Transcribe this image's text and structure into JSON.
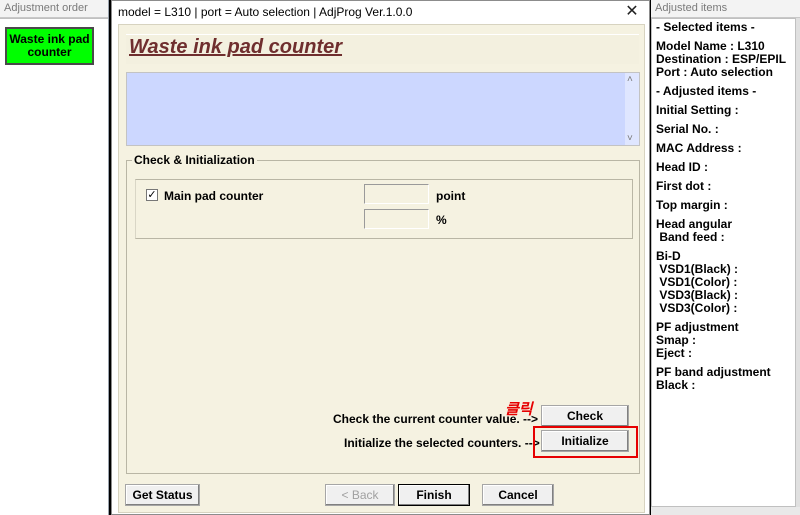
{
  "left_panel": {
    "title": "Adjustment order",
    "item": "Waste ink pad counter",
    "item_color": "#00ff00"
  },
  "right_panel": {
    "title": "Adjusted items",
    "lines": [
      "- Selected items -",
      "",
      "Model Name : L310",
      "Destination : ESP/EPIL",
      "Port : Auto selection",
      "",
      "- Adjusted items -",
      "",
      "Initial Setting :",
      "",
      "Serial No. :",
      "",
      "MAC Address :",
      "",
      "Head ID :",
      "",
      "First dot :",
      "",
      "Top margin :",
      "",
      "Head angular",
      " Band feed :",
      "",
      "Bi-D",
      " VSD1(Black) :",
      " VSD1(Color) :",
      " VSD3(Black) :",
      " VSD3(Color) :",
      "",
      "PF adjustment",
      "Smap :",
      "Eject :",
      "",
      "PF band adjustment",
      "Black :"
    ]
  },
  "dialog": {
    "window_title": "model = L310 | port = Auto selection | AdjProg Ver.1.0.0",
    "close_icon": "close-icon",
    "page_title": "Waste ink pad counter",
    "title_color": "#6f2e2e",
    "message_text": "",
    "group_label": "Check & Initialization",
    "main_pad": {
      "label": "Main pad counter",
      "checked": true,
      "check_mark": "✓",
      "point_value": "",
      "point_unit": "point",
      "percent_value": "",
      "percent_unit": "%"
    },
    "check_text": "Check the current counter value. -->",
    "init_text": "Initialize the selected counters. -->",
    "hand_note": "클릭",
    "highlight_color": "#e60000",
    "buttons": {
      "check": "Check",
      "initialize": "Initialize",
      "get_status": "Get Status",
      "back": "< Back",
      "finish": "Finish",
      "cancel": "Cancel"
    }
  }
}
